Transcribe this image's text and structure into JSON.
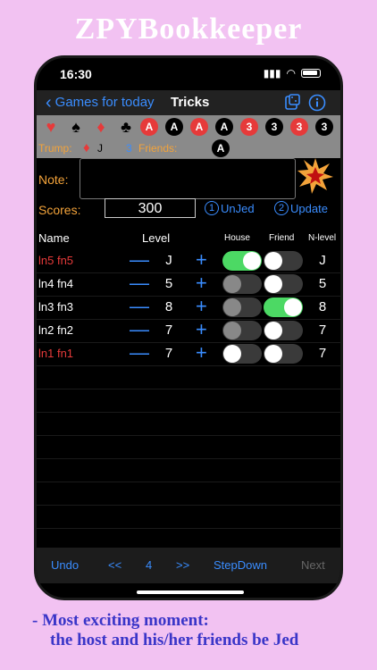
{
  "banner": {
    "title": "ZPYBookkeeper"
  },
  "status_bar": {
    "time": "16:30"
  },
  "nav": {
    "back_label": "Games for today",
    "title": "Tricks",
    "icons": [
      "cards-dice-icon",
      "info-icon"
    ]
  },
  "cards": [
    {
      "kind": "suit",
      "glyph": "♥",
      "color": "red"
    },
    {
      "kind": "suit",
      "glyph": "♠",
      "color": "black"
    },
    {
      "kind": "suit",
      "glyph": "♦",
      "color": "red"
    },
    {
      "kind": "suit",
      "glyph": "♣",
      "color": "black"
    },
    {
      "kind": "chip",
      "glyph": "A",
      "color": "red"
    },
    {
      "kind": "chip",
      "glyph": "A",
      "color": "black"
    },
    {
      "kind": "chip",
      "glyph": "A",
      "color": "red"
    },
    {
      "kind": "chip",
      "glyph": "A",
      "color": "black"
    },
    {
      "kind": "chip",
      "glyph": "3",
      "color": "red"
    },
    {
      "kind": "chip",
      "glyph": "3",
      "color": "black"
    },
    {
      "kind": "chip",
      "glyph": "3",
      "color": "red"
    },
    {
      "kind": "chip",
      "glyph": "3",
      "color": "black"
    }
  ],
  "trump": {
    "label": "Trump:",
    "suit": "♦",
    "rank": "J",
    "friends_count": "3",
    "friends_label": "Friends:",
    "friend_card": "A"
  },
  "note": {
    "label": "Note:",
    "value": ""
  },
  "scores": {
    "label": "Scores:",
    "value": "300",
    "unjed_num": "1",
    "unjed_label": "UnJed",
    "update_num": "2",
    "update_label": "Update"
  },
  "table": {
    "headers": {
      "name": "Name",
      "level": "Level",
      "house": "House",
      "friend": "Friend",
      "nlevel": "N-level"
    },
    "rows": [
      {
        "name": "ln5 fn5",
        "red": true,
        "level": "J",
        "house": "on",
        "friend": "off",
        "nlevel": "J"
      },
      {
        "name": "ln4 fn4",
        "red": false,
        "level": "5",
        "house": "grey",
        "friend": "off",
        "nlevel": "5"
      },
      {
        "name": "ln3 fn3",
        "red": false,
        "level": "8",
        "house": "grey",
        "friend": "on",
        "nlevel": "8"
      },
      {
        "name": "ln2 fn2",
        "red": false,
        "level": "7",
        "house": "grey",
        "friend": "off",
        "nlevel": "7"
      },
      {
        "name": "ln1 fn1",
        "red": true,
        "level": "7",
        "house": "off",
        "friend": "off",
        "nlevel": "7"
      }
    ],
    "minus": "—",
    "plus": "+"
  },
  "bottom_bar": {
    "undo": "Undo",
    "prev": "<<",
    "page": "4",
    "next_page": ">>",
    "stepdown": "StepDown",
    "next": "Next"
  },
  "caption": {
    "line1": "- Most exciting moment:",
    "line2": "the host and his/her friends be Jed"
  },
  "colors": {
    "background": "#f2c2f2",
    "accent": "#3a8dff",
    "orange": "#f3a33a",
    "red": "#e63a3a",
    "green": "#4cd964"
  }
}
